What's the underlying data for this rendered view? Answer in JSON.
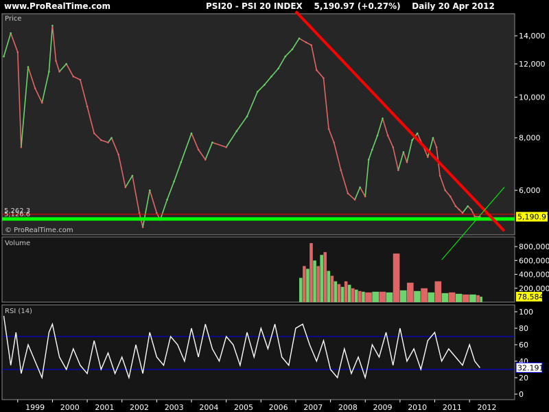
{
  "header": {
    "site": "www.ProRealTime.com",
    "title": "PSI20 - PSI 20 INDEX",
    "last": "5,190.97 (+0.27%)",
    "period": "Daily 20 Apr 2012"
  },
  "colors": {
    "up": "#6dd46d",
    "down": "#e06666",
    "trendline": "#ff0000",
    "support_line": "#00ff00",
    "resistance_line": "#ff0000",
    "rsi_line": "#ffffff",
    "rsi_level": "#0000ff",
    "marker_bg": "#ffff00"
  },
  "chart_data": [
    {
      "type": "line",
      "panel": "price",
      "title": "Price",
      "watermark": "© ProRealTime.com",
      "x_ticks": [
        "1999",
        "2000",
        "2001",
        "2002",
        "2003",
        "2004",
        "2005",
        "2006",
        "2007",
        "2008",
        "2009",
        "2010",
        "2011",
        "2012"
      ],
      "y_ticks": [
        "6,000",
        "8,000",
        "10,000",
        "12,000",
        "14,000"
      ],
      "ylim": [
        4700,
        15800
      ],
      "scale": "log",
      "last_value": "5,190.97",
      "levels": [
        {
          "label": "5,262.3",
          "value": 5262.3,
          "color": "#ff0000"
        },
        {
          "label": "5,126.6",
          "value": 5126.6,
          "color": "#00ff00"
        }
      ],
      "trendline": {
        "from": [
          2007.0,
          16000
        ],
        "to": [
          2013.0,
          4800
        ]
      },
      "support_trend": {
        "from": [
          2011.2,
          4100
        ],
        "to": [
          2013.0,
          6100
        ]
      },
      "series": [
        {
          "x": [
            1998.6,
            1998.8,
            1999.0,
            1999.1,
            1999.3,
            1999.5,
            1999.7,
            1999.9,
            2000.0,
            2000.1,
            2000.2,
            2000.4,
            2000.6,
            2000.8,
            2001.0,
            2001.2,
            2001.4,
            2001.6,
            2001.7,
            2001.9,
            2002.1,
            2002.3,
            2002.5,
            2002.6,
            2002.8,
            2003.0,
            2003.1,
            2003.3,
            2003.5,
            2003.7,
            2004.0,
            2004.2,
            2004.4,
            2004.6,
            2005.0,
            2005.3,
            2005.6,
            2005.9,
            2006.1,
            2006.3,
            2006.5,
            2006.7,
            2006.9,
            2007.1,
            2007.3,
            2007.45,
            2007.6,
            2007.8,
            2007.95,
            2008.1,
            2008.3,
            2008.5,
            2008.7,
            2008.85,
            2009.0,
            2009.1,
            2009.2,
            2009.35,
            2009.5,
            2009.65,
            2009.8,
            2009.95,
            2010.1,
            2010.2,
            2010.35,
            2010.5,
            2010.65,
            2010.8,
            2010.95,
            2011.05,
            2011.15,
            2011.3,
            2011.45,
            2011.6,
            2011.7,
            2011.8,
            2011.95,
            2012.05,
            2012.15,
            2012.3
          ],
          "values": [
            12500,
            14200,
            12800,
            7600,
            11800,
            10500,
            9700,
            11500,
            14800,
            12200,
            11500,
            12000,
            11200,
            11000,
            9500,
            8200,
            7900,
            7800,
            8000,
            7300,
            6100,
            6500,
            5300,
            4900,
            6000,
            5300,
            5100,
            5700,
            6300,
            7000,
            8200,
            7500,
            7100,
            7800,
            7600,
            8300,
            9000,
            10300,
            10700,
            11200,
            11700,
            12500,
            13000,
            13800,
            13500,
            13300,
            11600,
            11100,
            8400,
            7800,
            6700,
            5900,
            5700,
            6100,
            5800,
            7100,
            7500,
            8100,
            8900,
            8100,
            7600,
            6700,
            7400,
            7000,
            7900,
            8200,
            7700,
            7200,
            8000,
            7600,
            6500,
            6000,
            5800,
            5500,
            5400,
            5300,
            5500,
            5400,
            5200,
            5191
          ]
        }
      ]
    },
    {
      "type": "bar",
      "panel": "volume",
      "title": "Volume",
      "y_ticks": [
        "200,000",
        "400,000",
        "600,000",
        "800,000"
      ],
      "ylim": [
        0,
        900000
      ],
      "last_value": "78,584",
      "series": [
        {
          "x": [
            2007.1,
            2007.2,
            2007.3,
            2007.4,
            2007.5,
            2007.6,
            2007.7,
            2007.8,
            2007.9,
            2008.0,
            2008.1,
            2008.2,
            2008.3,
            2008.4,
            2008.5,
            2008.6,
            2008.7,
            2008.8,
            2008.9,
            2009.0,
            2009.2,
            2009.4,
            2009.6,
            2009.8,
            2010.0,
            2010.2,
            2010.4,
            2010.6,
            2010.8,
            2011.0,
            2011.2,
            2011.4,
            2011.6,
            2011.8,
            2012.0,
            2012.2,
            2012.3
          ],
          "values": [
            350000,
            520000,
            480000,
            850000,
            600000,
            520000,
            680000,
            720000,
            450000,
            380000,
            300000,
            260000,
            220000,
            300000,
            250000,
            200000,
            180000,
            160000,
            150000,
            140000,
            150000,
            150000,
            140000,
            700000,
            170000,
            280000,
            160000,
            200000,
            140000,
            300000,
            130000,
            140000,
            120000,
            110000,
            110000,
            100000,
            78584
          ]
        }
      ]
    },
    {
      "type": "line",
      "panel": "rsi",
      "title": "RSI (14)",
      "y_ticks": [
        "0",
        "20",
        "40",
        "60",
        "80",
        "100"
      ],
      "ylim": [
        0,
        100
      ],
      "levels": [
        30,
        70
      ],
      "last_value": "32.191",
      "series": [
        {
          "x": [
            1998.6,
            1998.8,
            1998.95,
            1999.1,
            1999.3,
            1999.5,
            1999.7,
            1999.9,
            2000.0,
            2000.2,
            2000.4,
            2000.6,
            2000.8,
            2001.0,
            2001.2,
            2001.4,
            2001.6,
            2001.8,
            2002.0,
            2002.2,
            2002.4,
            2002.6,
            2002.8,
            2003.0,
            2003.2,
            2003.4,
            2003.6,
            2003.8,
            2004.0,
            2004.2,
            2004.4,
            2004.6,
            2004.8,
            2005.0,
            2005.2,
            2005.4,
            2005.6,
            2005.8,
            2006.0,
            2006.2,
            2006.4,
            2006.6,
            2006.8,
            2007.0,
            2007.2,
            2007.4,
            2007.6,
            2007.8,
            2008.0,
            2008.2,
            2008.4,
            2008.6,
            2008.8,
            2009.0,
            2009.2,
            2009.4,
            2009.6,
            2009.8,
            2010.0,
            2010.2,
            2010.4,
            2010.6,
            2010.8,
            2011.0,
            2011.2,
            2011.4,
            2011.6,
            2011.8,
            2012.0,
            2012.15,
            2012.3
          ],
          "values": [
            95,
            35,
            75,
            25,
            60,
            40,
            20,
            75,
            85,
            45,
            30,
            55,
            35,
            25,
            65,
            30,
            50,
            25,
            45,
            20,
            60,
            25,
            75,
            45,
            35,
            70,
            60,
            40,
            80,
            45,
            85,
            55,
            40,
            70,
            60,
            35,
            75,
            45,
            80,
            55,
            85,
            45,
            35,
            80,
            85,
            60,
            40,
            65,
            30,
            20,
            55,
            25,
            45,
            20,
            60,
            45,
            75,
            35,
            80,
            40,
            55,
            30,
            65,
            75,
            40,
            55,
            45,
            35,
            60,
            40,
            32
          ]
        }
      ]
    }
  ]
}
